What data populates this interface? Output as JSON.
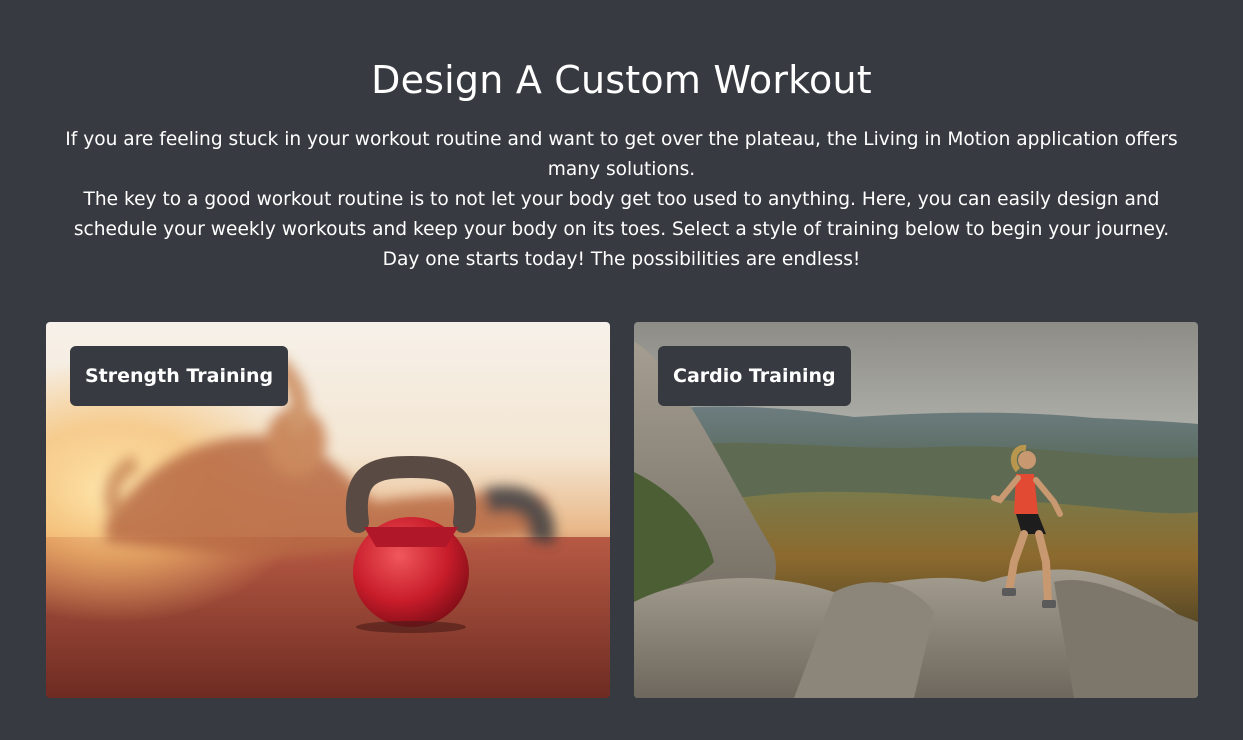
{
  "page": {
    "title": "Design A Custom Workout",
    "intro": [
      "If you are feeling stuck in your workout routine and want to get over the plateau, the Living in Motion application offers many solutions.",
      "The key to a good workout routine is to not let your body get too used to anything. Here, you can easily design and schedule your weekly workouts and keep your body on its toes. Select a style of training below to begin your journey.",
      "Day one starts today! The possibilities are endless!"
    ]
  },
  "cards": [
    {
      "label": "Strength Training",
      "image": "kettlebell-photo"
    },
    {
      "label": "Cardio Training",
      "image": "mountain-runner-photo"
    }
  ],
  "colors": {
    "background": "#373a40",
    "text": "#ffffff",
    "label_bg": "#373a40"
  }
}
